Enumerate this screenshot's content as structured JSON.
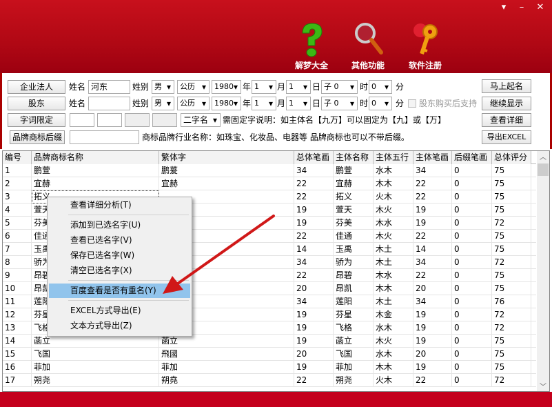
{
  "window": {
    "controls": [
      "▾",
      "–",
      "✕"
    ]
  },
  "toolbar": [
    {
      "label": "解梦大全",
      "icon": "question-icon"
    },
    {
      "label": "其他功能",
      "icon": "magnifier-icon"
    },
    {
      "label": "软件注册",
      "icon": "keys-icon"
    }
  ],
  "form": {
    "btn_legal": "企业法人",
    "btn_share": "股东",
    "btn_limit": "字词限定",
    "btn_suffix": "品牌商标后缀",
    "name_lbl": "姓名",
    "gender_lbl": "姓别",
    "name1": "河东",
    "name2": "",
    "gender": "男",
    "calendar": "公历",
    "year": "1980",
    "year_lbl": "年",
    "month": "1",
    "month_lbl": "月",
    "day": "1",
    "day_lbl": "日",
    "hour": "子 0",
    "hour_lbl": "时",
    "minute": "0",
    "minute_lbl": "分",
    "support_lbl": "股东购买后支持",
    "name_type": "二字名",
    "fixed_note": "需固定字说明：如主体名【九万】可以固定为【九】或【万】",
    "industry_note": "商标品牌行业名称：如珠宝、化妆品、电器等 品牌商标也可以不带后缀。",
    "btn_name": "马上起名",
    "btn_continue": "继续显示",
    "btn_detail": "查看详细",
    "btn_export": "导出EXCEL"
  },
  "table": {
    "headers": [
      "编号",
      "品牌商标名称",
      "繁体字",
      "总体笔画",
      "主体名称",
      "主体五行",
      "主体笔画",
      "后缀笔画",
      "总体评分"
    ],
    "rows": [
      [
        "1",
        "鹏萱",
        "鹏萲",
        "34",
        "鹏萱",
        "水木",
        "34",
        "0",
        "75"
      ],
      [
        "2",
        "宜赫",
        "宜赫",
        "22",
        "宜赫",
        "木木",
        "22",
        "0",
        "75"
      ],
      [
        "3",
        "拓义",
        "",
        "22",
        "拓义",
        "火木",
        "22",
        "0",
        "75"
      ],
      [
        "4",
        "萱天",
        "",
        "19",
        "萱天",
        "木火",
        "19",
        "0",
        "75"
      ],
      [
        "5",
        "芬美",
        "",
        "19",
        "芬美",
        "木水",
        "19",
        "0",
        "72"
      ],
      [
        "6",
        "佳通",
        "",
        "22",
        "佳通",
        "木火",
        "22",
        "0",
        "75"
      ],
      [
        "7",
        "玉禹",
        "",
        "14",
        "玉禹",
        "木土",
        "14",
        "0",
        "75"
      ],
      [
        "8",
        "骄为",
        "",
        "34",
        "骄为",
        "木土",
        "34",
        "0",
        "72"
      ],
      [
        "9",
        "昂碧",
        "",
        "22",
        "昂碧",
        "木水",
        "22",
        "0",
        "75"
      ],
      [
        "10",
        "昂凯",
        "",
        "20",
        "昂凯",
        "木木",
        "20",
        "0",
        "75"
      ],
      [
        "11",
        "莲阳",
        "",
        "34",
        "莲阳",
        "木土",
        "34",
        "0",
        "76"
      ],
      [
        "12",
        "芬星",
        "",
        "19",
        "芬星",
        "木金",
        "19",
        "0",
        "72"
      ],
      [
        "13",
        "飞格",
        "",
        "19",
        "飞格",
        "水木",
        "19",
        "0",
        "72"
      ],
      [
        "14",
        "菡立",
        "菡立",
        "19",
        "菡立",
        "木火",
        "19",
        "0",
        "75"
      ],
      [
        "15",
        "飞国",
        "飛國",
        "20",
        "飞国",
        "水木",
        "20",
        "0",
        "75"
      ],
      [
        "16",
        "菲加",
        "菲加",
        "19",
        "菲加",
        "木木",
        "19",
        "0",
        "75"
      ],
      [
        "17",
        "朔尧",
        "朔堯",
        "22",
        "朔尧",
        "火木",
        "22",
        "0",
        "72"
      ]
    ]
  },
  "menu": {
    "items": [
      "查看详细分析(T)",
      "添加到已选名字(U)",
      "查看已选名字(V)",
      "保存已选名字(W)",
      "清空已选名字(X)",
      "百度查看是否有重名(Y)",
      "EXCEL方式导出(E)",
      "文本方式导出(Z)"
    ]
  },
  "colors": {
    "brand": "#c0101c",
    "highlight": "#91c4ec",
    "arrow": "#d01818"
  }
}
